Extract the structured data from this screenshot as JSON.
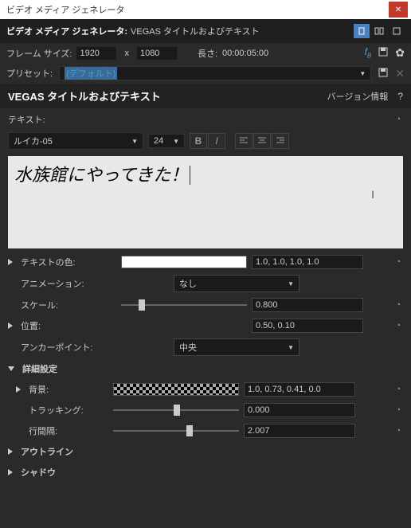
{
  "titlebar": {
    "title": "ビデオ メディア ジェネレータ"
  },
  "header": {
    "label": "ビデオ メディア ジェネレータ:",
    "sub": "VEGAS タイトルおよびテキスト"
  },
  "frame": {
    "label": "フレーム サイズ:",
    "w": "1920",
    "h": "1080",
    "x": "x",
    "len_label": "長さ:",
    "len": "00:00:05:00"
  },
  "preset": {
    "label": "プリセット:",
    "value": "(デフォルト)"
  },
  "section": {
    "title": "VEGAS タイトルおよびテキスト",
    "version": "バージョン情報",
    "q": "?"
  },
  "text": {
    "label": "テキスト:",
    "font": "ルイカ-05",
    "size": "24",
    "content": "水族館にやってきた！"
  },
  "props": {
    "color_label": "テキストの色:",
    "color_val": "1.0, 1.0, 1.0, 1.0",
    "anim_label": "アニメーション:",
    "anim_val": "なし",
    "scale_label": "スケール:",
    "scale_val": "0.800",
    "pos_label": "位置:",
    "pos_val": "0.50, 0.10",
    "anchor_label": "アンカーポイント:",
    "anchor_val": "中央",
    "adv_label": "詳細設定",
    "bg_label": "背景:",
    "bg_val": "1.0, 0.73, 0.41, 0.0",
    "track_label": "トラッキング:",
    "track_val": "0.000",
    "line_label": "行間隔:",
    "line_val": "2.007",
    "outline_label": "アウトライン",
    "shadow_label": "シャドウ"
  }
}
